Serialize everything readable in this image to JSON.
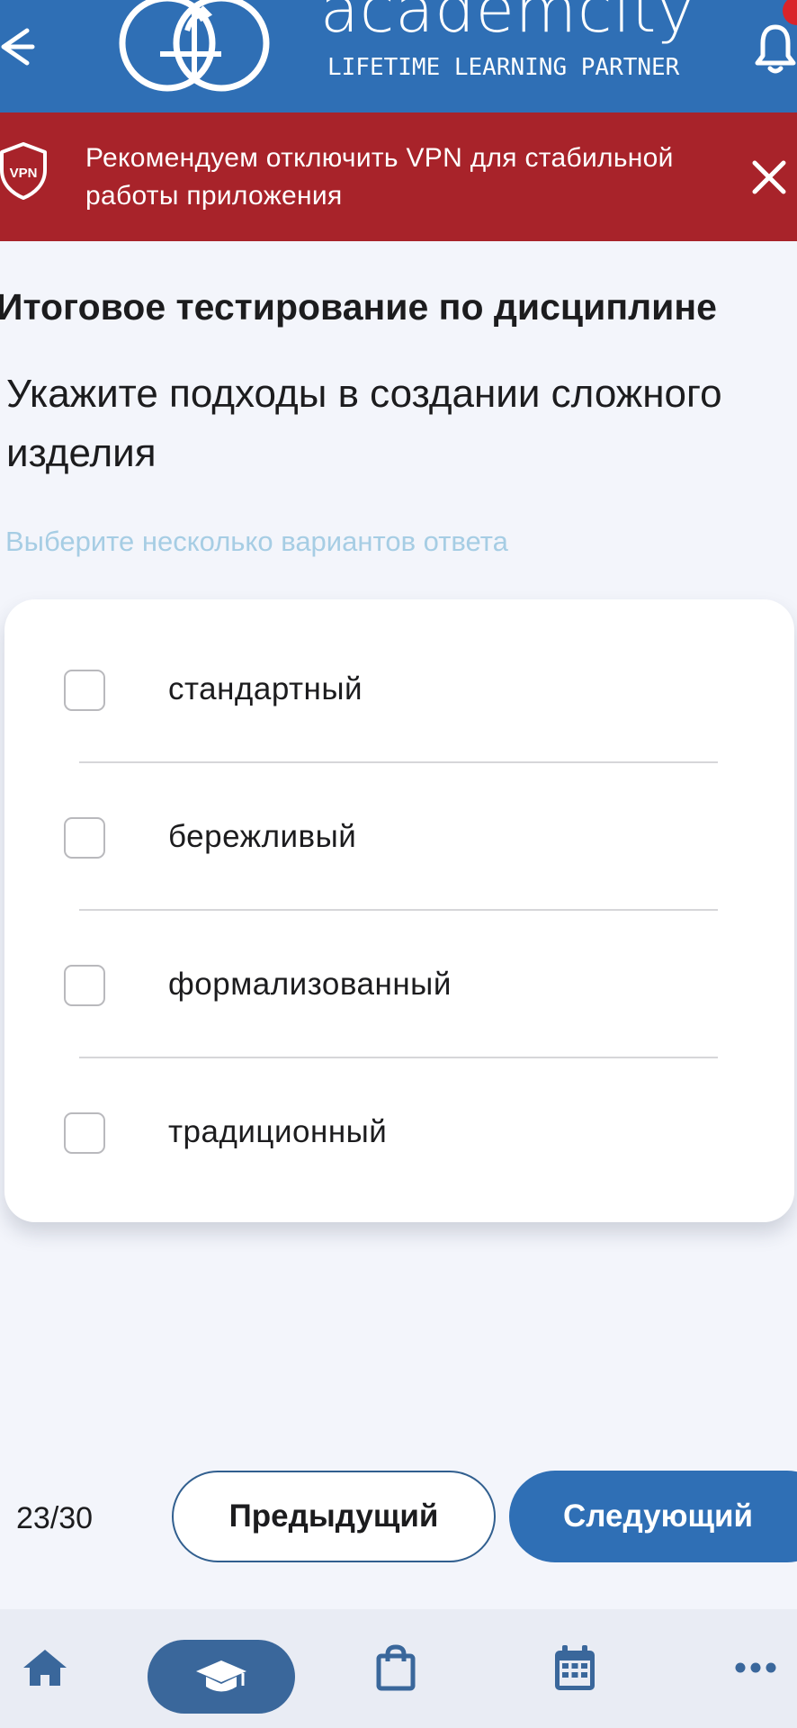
{
  "header": {
    "logo_word": "academcity",
    "logo_tagline": "LIFETIME LEARNING PARTNER",
    "colors": {
      "background": "#2f6fb5",
      "notification_dot": "#d9242a"
    },
    "icons": {
      "back": "arrow-left-icon",
      "notifications": "bell-icon"
    }
  },
  "vpn_banner": {
    "icon_label": "VPN",
    "message": "Рекомендуем отключить VPN для стабильной работы приложения",
    "background_color": "#a8232a",
    "icons": {
      "shield": "vpn-shield-icon",
      "close": "close-icon"
    }
  },
  "test": {
    "title": "Итоговое тестирование по дисциплине",
    "question": "Укажите подходы в создании сложного изделия",
    "hint": "Выберите несколько вариантов ответа",
    "options": [
      {
        "label": "стандартный",
        "checked": false
      },
      {
        "label": "бережливый",
        "checked": false
      },
      {
        "label": "формализованный",
        "checked": false
      },
      {
        "label": "традиционный",
        "checked": false
      }
    ]
  },
  "pager": {
    "counter": "23/30",
    "prev_label": "Предыдущий",
    "next_label": "Следующий",
    "accent_color": "#2f6fb5"
  },
  "bottom_nav": {
    "items": [
      {
        "icon": "home-icon",
        "active": false
      },
      {
        "icon": "graduation-cap-icon",
        "active": true
      },
      {
        "icon": "shopping-bag-icon",
        "active": false
      },
      {
        "icon": "calendar-icon",
        "active": false
      },
      {
        "icon": "more-dots-icon",
        "active": false
      }
    ],
    "active_color": "#3a679b"
  }
}
